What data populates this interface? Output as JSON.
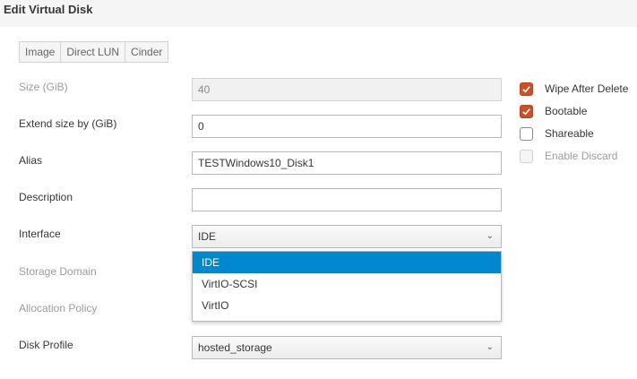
{
  "dialog": {
    "title": "Edit Virtual Disk"
  },
  "tabs": [
    {
      "label": "Image"
    },
    {
      "label": "Direct LUN"
    },
    {
      "label": "Cinder"
    }
  ],
  "form": {
    "size": {
      "label": "Size (GiB)",
      "value": "40"
    },
    "extend": {
      "label": "Extend size by (GiB)",
      "value": "0"
    },
    "alias": {
      "label": "Alias",
      "value": "TESTWindows10_Disk1"
    },
    "description": {
      "label": "Description",
      "value": ""
    },
    "interface": {
      "label": "Interface",
      "selected": "IDE",
      "options": [
        "IDE",
        "VirtIO-SCSI",
        "VirtIO"
      ]
    },
    "storage_domain": {
      "label": "Storage Domain"
    },
    "allocation_policy": {
      "label": "Allocation Policy"
    },
    "disk_profile": {
      "label": "Disk Profile",
      "selected": "hosted_storage"
    }
  },
  "options": {
    "wipe_after_delete": {
      "label": "Wipe After Delete",
      "checked": true
    },
    "bootable": {
      "label": "Bootable",
      "checked": true
    },
    "shareable": {
      "label": "Shareable",
      "checked": false
    },
    "enable_discard": {
      "label": "Enable Discard",
      "checked": false,
      "disabled": true
    }
  },
  "colors": {
    "checkbox_checked": "#c9512a",
    "dropdown_highlight": "#0088ce"
  }
}
